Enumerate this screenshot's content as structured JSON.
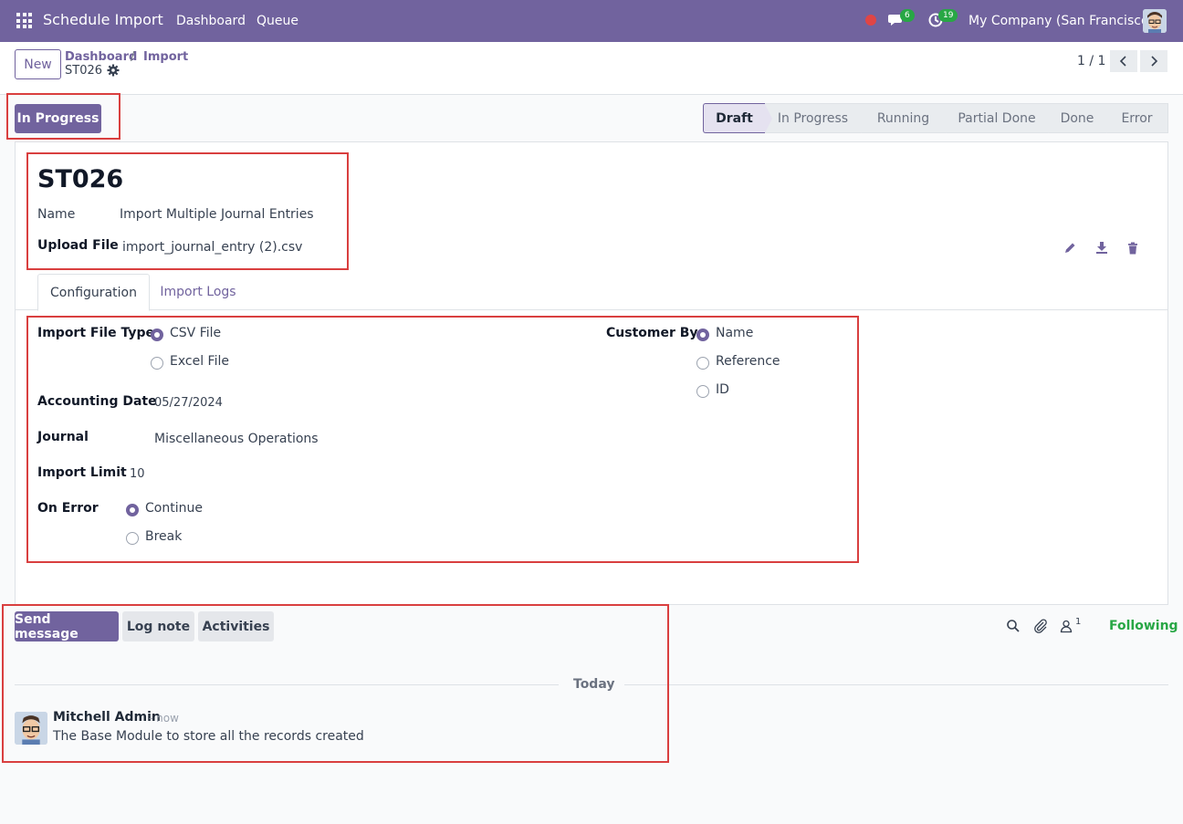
{
  "navbar": {
    "app_title": "Schedule Import",
    "menu": [
      "Dashboard",
      "Queue"
    ],
    "messages_count": "6",
    "activities_count": "19",
    "company": "My Company (San Francisco)"
  },
  "control_panel": {
    "new_label": "New",
    "breadcrumbs": [
      "Dashboard",
      "Import"
    ],
    "breadcrumb_sep": "/",
    "record_name": "ST026",
    "pager": "1 / 1"
  },
  "status": {
    "action_label": "In Progress",
    "stages": [
      "Draft",
      "In Progress",
      "Running",
      "Partial Done",
      "Done",
      "Error"
    ],
    "current_stage": "Draft"
  },
  "form": {
    "title": "ST026",
    "name_label": "Name",
    "name_value": "Import Multiple Journal Entries",
    "upload_label": "Upload File",
    "upload_value": "import_journal_entry (2).csv",
    "tabs": [
      "Configuration",
      "Import Logs"
    ],
    "file_type_label": "Import File Type",
    "file_type_options": [
      "CSV File",
      "Excel File"
    ],
    "file_type_selected": "CSV File",
    "accounting_date_label": "Accounting Date",
    "accounting_date_value": "05/27/2024",
    "journal_label": "Journal",
    "journal_value": "Miscellaneous Operations",
    "import_limit_label": "Import Limit",
    "import_limit_value": "10",
    "on_error_label": "On Error",
    "on_error_options": [
      "Continue",
      "Break"
    ],
    "on_error_selected": "Continue",
    "customer_by_label": "Customer By",
    "customer_by_options": [
      "Name",
      "Reference",
      "ID"
    ],
    "customer_by_selected": "Name"
  },
  "chatter": {
    "send_message": "Send message",
    "log_note": "Log note",
    "activities": "Activities",
    "followers_count": "1",
    "following": "Following",
    "date_separator": "Today",
    "message": {
      "author": "Mitchell Admin",
      "time": "- now",
      "body": "The Base Module to store all the records created"
    }
  },
  "colors": {
    "brand": "#71639e",
    "highlight": "#d93f3f",
    "following": "#28a745"
  }
}
